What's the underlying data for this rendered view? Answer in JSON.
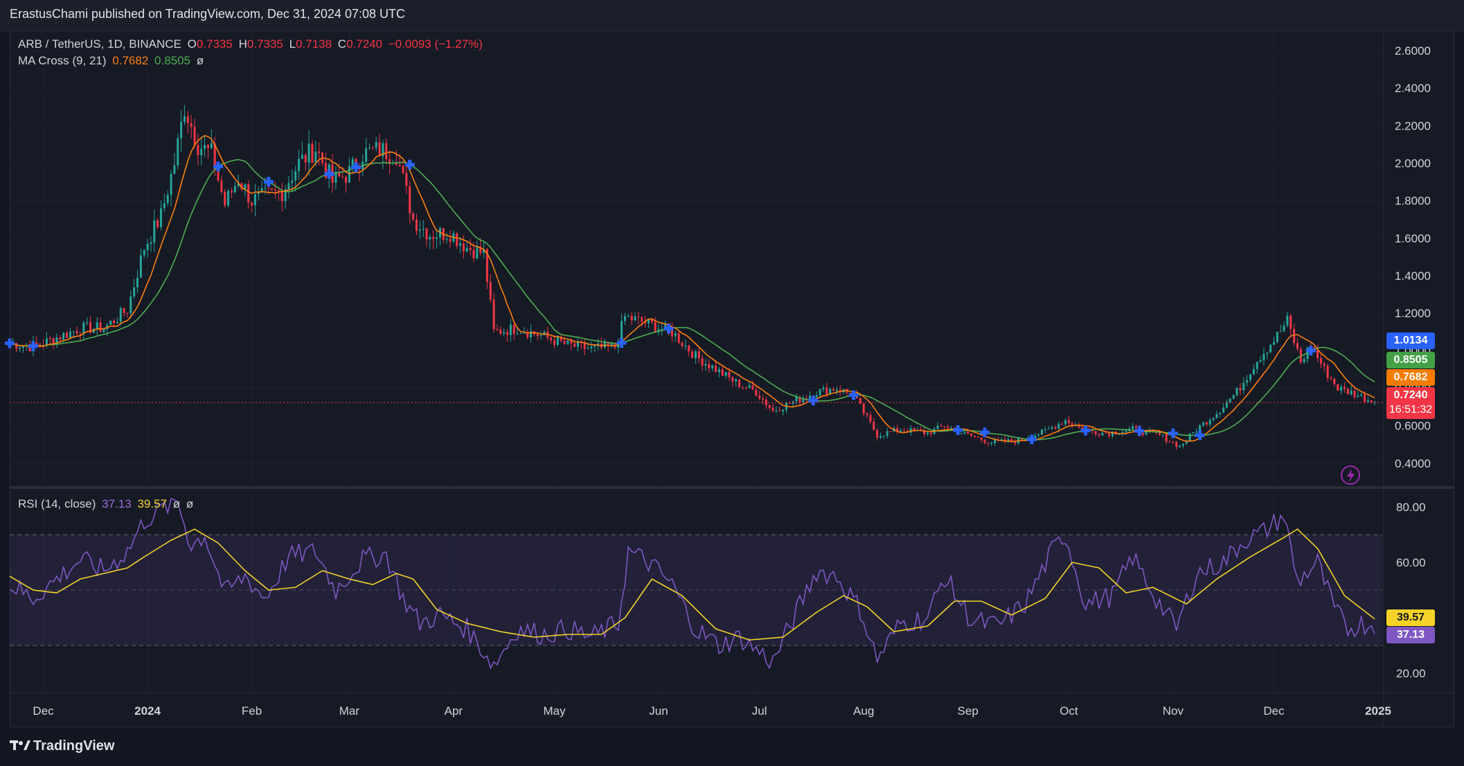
{
  "header": {
    "published": "ErastusChami published on TradingView.com, Dec 31, 2024 07:08 UTC"
  },
  "legend": {
    "symbol": "ARB / TetherUS, 1D, BINANCE",
    "o_label": "O",
    "o_value": "0.7335",
    "h_label": "H",
    "h_value": "0.7335",
    "l_label": "L",
    "l_value": "0.7138",
    "c_label": "C",
    "c_value": "0.7240",
    "change": "−0.0093 (−1.27%)",
    "ma_label": "MA Cross (9, 21)",
    "ma_fast": "0.7682",
    "ma_slow": "0.8505",
    "ma_extra": "ø",
    "rsi_label": "RSI (14, close)",
    "rsi_value": "37.13",
    "rsi_ma": "39.57",
    "rsi_extra1": "ø",
    "rsi_extra2": "ø"
  },
  "price_tags": {
    "cross": "1.0134",
    "ma_slow": "0.8505",
    "ma_fast": "0.7682",
    "last": "0.7240",
    "countdown": "16:51:32",
    "rsi_ma": "39.57",
    "rsi": "37.13"
  },
  "brand": {
    "name": "TradingView"
  },
  "colors": {
    "up": "#26a69a",
    "down": "#f23645",
    "ma_fast": "#ff7f0e",
    "ma_slow": "#4caf50",
    "rsi": "#7e57c2",
    "rsi_ma": "#f5d328",
    "cross": "#2962ff",
    "background": "#131722"
  },
  "chart_data": [
    {
      "type": "candlestick",
      "title": "ARB / TetherUS, 1D, BINANCE",
      "y_ticks": [
        0.4,
        0.6,
        0.8,
        1.0,
        1.2,
        1.4,
        1.6,
        1.8,
        2.0,
        2.2,
        2.4,
        2.6
      ],
      "y_tick_labels": [
        "0.4000",
        "0.6000",
        "0.8000",
        "1.0000",
        "1.2000",
        "1.4000",
        "1.6000",
        "1.8000",
        "2.0000",
        "2.2000",
        "2.4000",
        "2.6000"
      ],
      "ylim": [
        0.27,
        2.7
      ],
      "x_ticks": [
        "Dec",
        "2024",
        "Feb",
        "Mar",
        "Apr",
        "May",
        "Jun",
        "Jul",
        "Aug",
        "Sep",
        "Oct",
        "Nov",
        "Dec",
        "2025"
      ],
      "x_tick_dates": [
        "2023-12-01",
        "2024-01-01",
        "2024-02-01",
        "2024-03-01",
        "2024-04-01",
        "2024-05-01",
        "2024-06-01",
        "2024-07-01",
        "2024-08-01",
        "2024-09-01",
        "2024-10-01",
        "2024-11-01",
        "2024-12-01",
        "2025-01-01"
      ],
      "x_range_dates": [
        "2023-11-21",
        "2025-01-01"
      ],
      "series": [
        {
          "name": "ARB close (approx.)",
          "points": [
            [
              "2023-11-21",
              1.04
            ],
            [
              "2023-11-28",
              1.02
            ],
            [
              "2023-12-05",
              1.07
            ],
            [
              "2023-12-12",
              1.12
            ],
            [
              "2023-12-19",
              1.12
            ],
            [
              "2023-12-26",
              1.22
            ],
            [
              "2023-12-31",
              1.55
            ],
            [
              "2024-01-05",
              1.72
            ],
            [
              "2024-01-09",
              2.0
            ],
            [
              "2024-01-12",
              2.3
            ],
            [
              "2024-01-16",
              2.1
            ],
            [
              "2024-01-20",
              2.05
            ],
            [
              "2024-01-24",
              1.78
            ],
            [
              "2024-01-28",
              1.92
            ],
            [
              "2024-02-01",
              1.8
            ],
            [
              "2024-02-05",
              1.82
            ],
            [
              "2024-02-10",
              1.85
            ],
            [
              "2024-02-15",
              2.0
            ],
            [
              "2024-02-20",
              2.08
            ],
            [
              "2024-02-25",
              1.9
            ],
            [
              "2024-03-01",
              1.95
            ],
            [
              "2024-03-05",
              2.05
            ],
            [
              "2024-03-10",
              2.07
            ],
            [
              "2024-03-15",
              2.05
            ],
            [
              "2024-03-20",
              1.7
            ],
            [
              "2024-03-25",
              1.62
            ],
            [
              "2024-03-31",
              1.63
            ],
            [
              "2024-04-05",
              1.55
            ],
            [
              "2024-04-10",
              1.52
            ],
            [
              "2024-04-13",
              1.1
            ],
            [
              "2024-04-20",
              1.12
            ],
            [
              "2024-04-27",
              1.08
            ],
            [
              "2024-05-05",
              1.03
            ],
            [
              "2024-05-12",
              1.01
            ],
            [
              "2024-05-19",
              1.02
            ],
            [
              "2024-05-22",
              1.18
            ],
            [
              "2024-05-28",
              1.15
            ],
            [
              "2024-06-05",
              1.1
            ],
            [
              "2024-06-12",
              0.97
            ],
            [
              "2024-06-18",
              0.9
            ],
            [
              "2024-06-24",
              0.83
            ],
            [
              "2024-06-30",
              0.78
            ],
            [
              "2024-07-05",
              0.68
            ],
            [
              "2024-07-10",
              0.72
            ],
            [
              "2024-07-18",
              0.78
            ],
            [
              "2024-07-24",
              0.8
            ],
            [
              "2024-07-29",
              0.76
            ],
            [
              "2024-08-05",
              0.55
            ],
            [
              "2024-08-12",
              0.58
            ],
            [
              "2024-08-20",
              0.56
            ],
            [
              "2024-08-25",
              0.6
            ],
            [
              "2024-09-01",
              0.55
            ],
            [
              "2024-09-08",
              0.51
            ],
            [
              "2024-09-16",
              0.52
            ],
            [
              "2024-09-24",
              0.57
            ],
            [
              "2024-09-30",
              0.63
            ],
            [
              "2024-10-05",
              0.58
            ],
            [
              "2024-10-12",
              0.56
            ],
            [
              "2024-10-20",
              0.58
            ],
            [
              "2024-10-28",
              0.55
            ],
            [
              "2024-11-03",
              0.49
            ],
            [
              "2024-11-08",
              0.58
            ],
            [
              "2024-11-14",
              0.67
            ],
            [
              "2024-11-20",
              0.78
            ],
            [
              "2024-11-26",
              0.95
            ],
            [
              "2024-12-02",
              1.08
            ],
            [
              "2024-12-05",
              1.16
            ],
            [
              "2024-12-09",
              0.94
            ],
            [
              "2024-12-12",
              1.03
            ],
            [
              "2024-12-16",
              0.9
            ],
            [
              "2024-12-20",
              0.8
            ],
            [
              "2024-12-25",
              0.77
            ],
            [
              "2024-12-31",
              0.724
            ]
          ]
        }
      ],
      "overlays": [
        {
          "name": "MA 9",
          "color": "#ff7f0e"
        },
        {
          "name": "MA 21",
          "color": "#4caf50"
        }
      ],
      "cross_markers": [
        "2023-11-21",
        "2023-11-28",
        "2024-01-22",
        "2024-02-06",
        "2024-02-24",
        "2024-03-03",
        "2024-03-19",
        "2024-05-21",
        "2024-06-04",
        "2024-07-17",
        "2024-07-29",
        "2024-08-29",
        "2024-09-06",
        "2024-09-20",
        "2024-10-06",
        "2024-10-22",
        "2024-11-01",
        "2024-11-09",
        "2024-12-12"
      ],
      "last_value": 0.724
    },
    {
      "type": "line",
      "title": "RSI (14, close)",
      "y_ticks": [
        20,
        40,
        60,
        80
      ],
      "y_tick_labels": [
        "20.00",
        "40.00",
        "60.00",
        "80.00"
      ],
      "ylim": [
        13,
        84
      ],
      "bands": [
        30,
        50,
        70
      ],
      "series": [
        {
          "name": "RSI",
          "points": [
            [
              "2023-11-21",
              52
            ],
            [
              "2023-11-28",
              47
            ],
            [
              "2023-12-05",
              54
            ],
            [
              "2023-12-12",
              61
            ],
            [
              "2023-12-19",
              57
            ],
            [
              "2023-12-26",
              64
            ],
            [
              "2023-12-31",
              75
            ],
            [
              "2024-01-05",
              79
            ],
            [
              "2024-01-10",
              82
            ],
            [
              "2024-01-14",
              66
            ],
            [
              "2024-01-18",
              70
            ],
            [
              "2024-01-24",
              49
            ],
            [
              "2024-01-30",
              55
            ],
            [
              "2024-02-05",
              47
            ],
            [
              "2024-02-12",
              62
            ],
            [
              "2024-02-20",
              64
            ],
            [
              "2024-02-26",
              50
            ],
            [
              "2024-03-05",
              61
            ],
            [
              "2024-03-12",
              63
            ],
            [
              "2024-03-17",
              47
            ],
            [
              "2024-03-22",
              38
            ],
            [
              "2024-03-28",
              41
            ],
            [
              "2024-04-05",
              36
            ],
            [
              "2024-04-13",
              23
            ],
            [
              "2024-04-20",
              36
            ],
            [
              "2024-04-28",
              34
            ],
            [
              "2024-05-05",
              36
            ],
            [
              "2024-05-12",
              33
            ],
            [
              "2024-05-20",
              38
            ],
            [
              "2024-05-23",
              64
            ],
            [
              "2024-05-29",
              60
            ],
            [
              "2024-06-05",
              52
            ],
            [
              "2024-06-12",
              36
            ],
            [
              "2024-06-19",
              30
            ],
            [
              "2024-06-25",
              33
            ],
            [
              "2024-07-05",
              24
            ],
            [
              "2024-07-12",
              42
            ],
            [
              "2024-07-18",
              57
            ],
            [
              "2024-07-24",
              55
            ],
            [
              "2024-07-31",
              43
            ],
            [
              "2024-08-05",
              25
            ],
            [
              "2024-08-12",
              38
            ],
            [
              "2024-08-20",
              40
            ],
            [
              "2024-08-25",
              55
            ],
            [
              "2024-09-02",
              39
            ],
            [
              "2024-09-10",
              37
            ],
            [
              "2024-09-18",
              45
            ],
            [
              "2024-09-26",
              64
            ],
            [
              "2024-09-30",
              70
            ],
            [
              "2024-10-06",
              45
            ],
            [
              "2024-10-14",
              48
            ],
            [
              "2024-10-20",
              62
            ],
            [
              "2024-10-27",
              47
            ],
            [
              "2024-11-02",
              36
            ],
            [
              "2024-11-08",
              56
            ],
            [
              "2024-11-16",
              60
            ],
            [
              "2024-11-22",
              68
            ],
            [
              "2024-11-28",
              71
            ],
            [
              "2024-12-04",
              77
            ],
            [
              "2024-12-08",
              53
            ],
            [
              "2024-12-14",
              60
            ],
            [
              "2024-12-19",
              43
            ],
            [
              "2024-12-23",
              36
            ],
            [
              "2024-12-27",
              38
            ],
            [
              "2024-12-31",
              37.13
            ]
          ]
        },
        {
          "name": "RSI MA",
          "points": [
            [
              "2023-11-21",
              55
            ],
            [
              "2023-11-28",
              50
            ],
            [
              "2023-12-05",
              49
            ],
            [
              "2023-12-12",
              54
            ],
            [
              "2023-12-19",
              56
            ],
            [
              "2023-12-26",
              58
            ],
            [
              "2023-12-31",
              62
            ],
            [
              "2024-01-08",
              68
            ],
            [
              "2024-01-15",
              72
            ],
            [
              "2024-01-22",
              67
            ],
            [
              "2024-01-30",
              57
            ],
            [
              "2024-02-06",
              50
            ],
            [
              "2024-02-14",
              51
            ],
            [
              "2024-02-22",
              57
            ],
            [
              "2024-03-01",
              54
            ],
            [
              "2024-03-08",
              52
            ],
            [
              "2024-03-15",
              56
            ],
            [
              "2024-03-20",
              54
            ],
            [
              "2024-03-27",
              43
            ],
            [
              "2024-04-05",
              38
            ],
            [
              "2024-04-15",
              35
            ],
            [
              "2024-04-25",
              33
            ],
            [
              "2024-05-05",
              34
            ],
            [
              "2024-05-15",
              34
            ],
            [
              "2024-05-22",
              40
            ],
            [
              "2024-05-30",
              54
            ],
            [
              "2024-06-08",
              48
            ],
            [
              "2024-06-18",
              36
            ],
            [
              "2024-06-28",
              32
            ],
            [
              "2024-07-08",
              33
            ],
            [
              "2024-07-18",
              42
            ],
            [
              "2024-07-26",
              48
            ],
            [
              "2024-08-02",
              44
            ],
            [
              "2024-08-10",
              35
            ],
            [
              "2024-08-20",
              37
            ],
            [
              "2024-08-28",
              46
            ],
            [
              "2024-09-05",
              46
            ],
            [
              "2024-09-14",
              41
            ],
            [
              "2024-09-24",
              47
            ],
            [
              "2024-10-02",
              60
            ],
            [
              "2024-10-10",
              58
            ],
            [
              "2024-10-18",
              49
            ],
            [
              "2024-10-26",
              51
            ],
            [
              "2024-11-05",
              45
            ],
            [
              "2024-11-14",
              54
            ],
            [
              "2024-11-24",
              62
            ],
            [
              "2024-12-04",
              69
            ],
            [
              "2024-12-08",
              72
            ],
            [
              "2024-12-14",
              65
            ],
            [
              "2024-12-22",
              48
            ],
            [
              "2024-12-31",
              39.57
            ]
          ]
        }
      ]
    }
  ]
}
